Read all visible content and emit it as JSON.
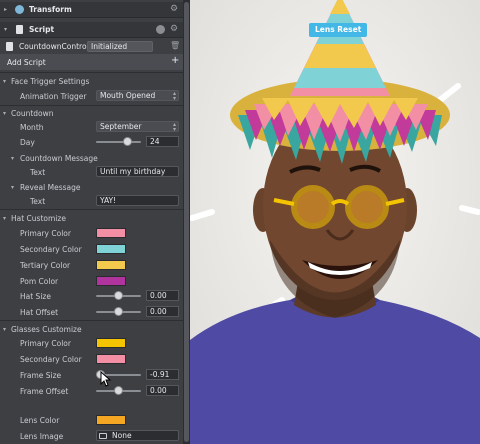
{
  "inspector": {
    "transform_label": "Transform",
    "script_label": "Script",
    "script_field": "CountdownContro",
    "script_state": "Initialized",
    "add_script_label": "Add Script",
    "face_trigger": {
      "header": "Face Trigger Settings",
      "animation_trigger_label": "Animation Trigger",
      "animation_trigger_value": "Mouth Opened"
    },
    "countdown": {
      "header": "Countdown",
      "month_label": "Month",
      "month_value": "September",
      "day_label": "Day",
      "day_value": "24",
      "message_header": "Countdown Message",
      "message_text_label": "Text",
      "message_text_value": "Until my birthday",
      "reveal_header": "Reveal Message",
      "reveal_text_label": "Text",
      "reveal_text_value": "YAY!"
    },
    "hat": {
      "header": "Hat Customize",
      "primary_label": "Primary Color",
      "secondary_label": "Secondary Color",
      "tertiary_label": "Tertiary Color",
      "pom_label": "Pom Color",
      "size_label": "Hat Size",
      "size_value": "0.00",
      "offset_label": "Hat Offset",
      "offset_value": "0.00",
      "colors": {
        "primary": "#f28fa5",
        "secondary": "#7fd3d6",
        "tertiary": "#f2c94c",
        "pom": "#b0339e"
      }
    },
    "glasses": {
      "header": "Glasses Customize",
      "primary_label": "Primary Color",
      "secondary_label": "Secondary Color",
      "frame_size_label": "Frame Size",
      "frame_size_value": "-0.91",
      "frame_offset_label": "Frame Offset",
      "frame_offset_value": "0.00",
      "lens_color_label": "Lens Color",
      "lens_image_label": "Lens Image",
      "lens_image_value": "None",
      "colors": {
        "primary": "#f5c400",
        "secondary": "#f28fa5",
        "lens": "#f5a623"
      }
    }
  },
  "preview": {
    "lens_reset_label": "Lens Reset"
  },
  "sliders": {
    "day": 0.7,
    "hat_size": 0.5,
    "hat_offset": 0.5,
    "frame_size": 0.1,
    "frame_offset": 0.5
  }
}
